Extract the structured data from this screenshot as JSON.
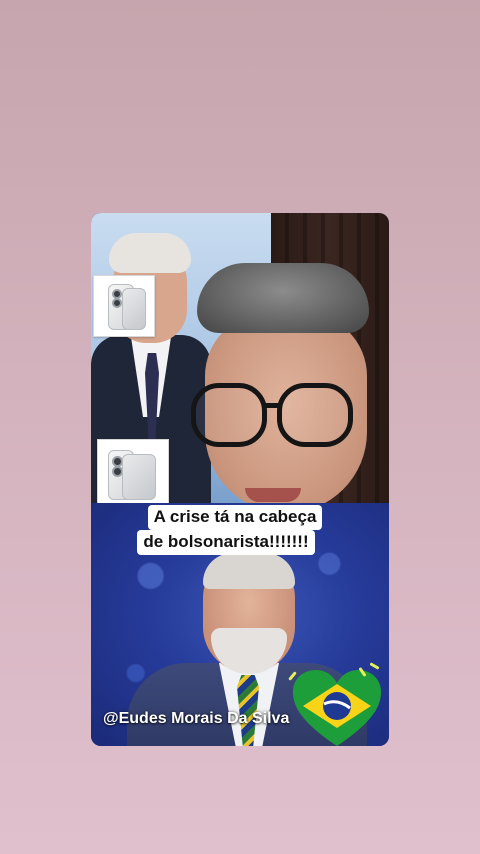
{
  "caption": {
    "line_1": "A crise tá na cabeça",
    "line_2": "de bolsonarista!!!!!!!"
  },
  "watermark": {
    "text": "@Eudes Morais Da Silva"
  },
  "stickers": {
    "product_icon": "smartphone-icon",
    "flag_icon": "brazil-flag-heart-icon"
  },
  "colors": {
    "background_top": "#c7a5ae",
    "background_bottom": "#e0c0cd",
    "panel_blue": "#263b9a",
    "flag_green": "#1e9e3a",
    "flag_yellow": "#f7d417",
    "flag_blue": "#1f3a93"
  }
}
